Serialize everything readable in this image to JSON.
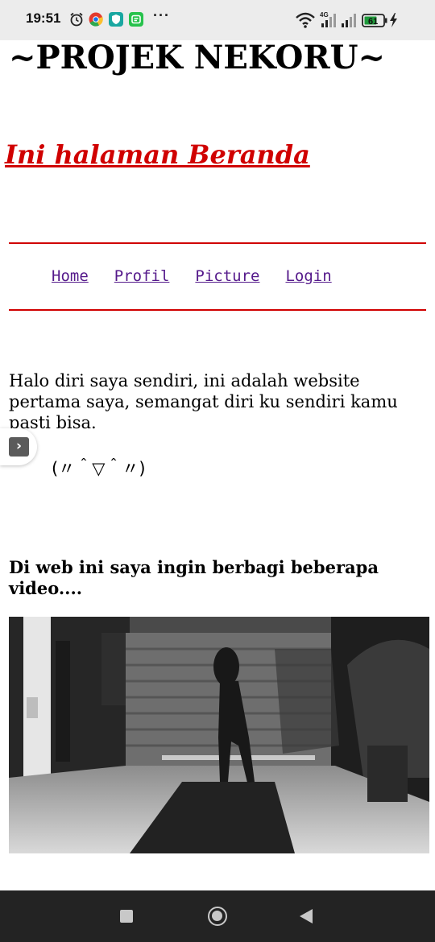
{
  "status_bar": {
    "time": "19:51",
    "network": "4G",
    "battery": "61",
    "icons": [
      "alarm-icon",
      "chrome-icon",
      "shield-app-icon",
      "message-app-icon",
      "more-notifications-icon",
      "wifi-icon",
      "signal-icon",
      "signal-icon",
      "battery-icon",
      "charging-icon"
    ]
  },
  "page": {
    "site_title": "~PROJEK NEKORU~",
    "heading": "Ini halaman Beranda",
    "nav": {
      "home": "Home",
      "profil": "Profil",
      "picture": "Picture",
      "login": "Login"
    },
    "intro_text": "Halo diri saya sendiri, ini adalah website pertama saya, semangat diri ku sendiri kamu pasti bisa.",
    "kaomoji": "(〃＾▽＾〃)",
    "video_heading": "Di web ini saya ingin berbagi beberapa video....",
    "side_button_icon": "chevron-right-icon"
  },
  "colors": {
    "accent_red": "#d00000",
    "link_visited": "#551a8b",
    "status_bar_bg": "#ececec",
    "nav_bar_bg": "#232323"
  },
  "system_nav": {
    "icons": [
      "recent-apps-icon",
      "home-icon",
      "back-icon"
    ]
  }
}
